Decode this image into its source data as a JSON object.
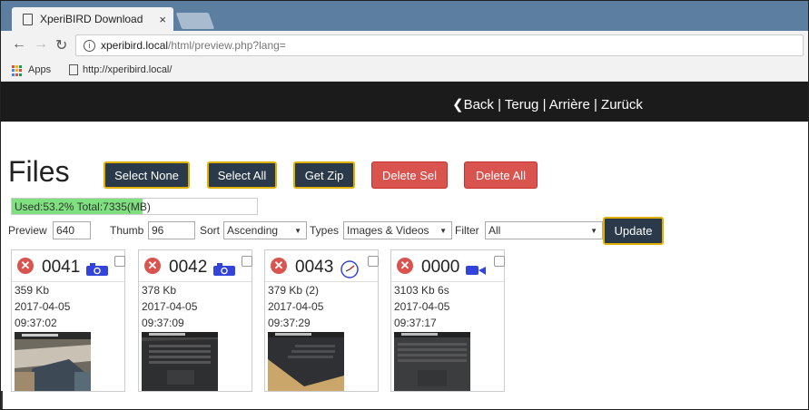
{
  "browser": {
    "tab_title": "XperiBIRD Download",
    "tab_close": "×",
    "url_host": "xperibird.local",
    "url_path": "/html/preview.php?lang=",
    "bookmarks": {
      "apps": "Apps",
      "link": "http://xperibird.local/"
    }
  },
  "header": {
    "back_link": "❮Back | Terug | Arrière | Zurück"
  },
  "page": {
    "title": "Files",
    "buttons": {
      "select_none": "Select None",
      "select_all": "Select All",
      "get_zip": "Get Zip",
      "delete_sel": "Delete Sel",
      "delete_all": "Delete All",
      "update": "Update"
    },
    "usage": {
      "text": "Used:53.2% Total:7335(MB)",
      "used_fraction": 0.532
    },
    "controls": {
      "preview_label": "Preview",
      "preview_value": "640",
      "thumb_label": "Thumb",
      "thumb_value": "96",
      "sort_label": "Sort",
      "sort_value": "Ascending",
      "types_label": "Types",
      "types_value": "Images & Videos",
      "filter_label": "Filter",
      "filter_value": "All"
    }
  },
  "files": [
    {
      "number": "0041",
      "kind": "camera-icon",
      "size": "359 Kb",
      "date": "2017-04-05",
      "time": "09:37:02"
    },
    {
      "number": "0042",
      "kind": "camera-icon",
      "size": "378 Kb",
      "date": "2017-04-05",
      "time": "09:37:09"
    },
    {
      "number": "0043",
      "kind": "timelapse-icon",
      "size": "379 Kb (2)",
      "date": "2017-04-05",
      "time": "09:37:29"
    },
    {
      "number": "0000",
      "kind": "video-camera-icon",
      "size": "3103 Kb 6s",
      "date": "2017-04-05",
      "time": "09:37:17"
    }
  ],
  "colors": {
    "accent_border": "#e0b000",
    "dark_button": "#2b3a4a",
    "danger": "#d9534f",
    "icon_blue": "#3344dd"
  }
}
